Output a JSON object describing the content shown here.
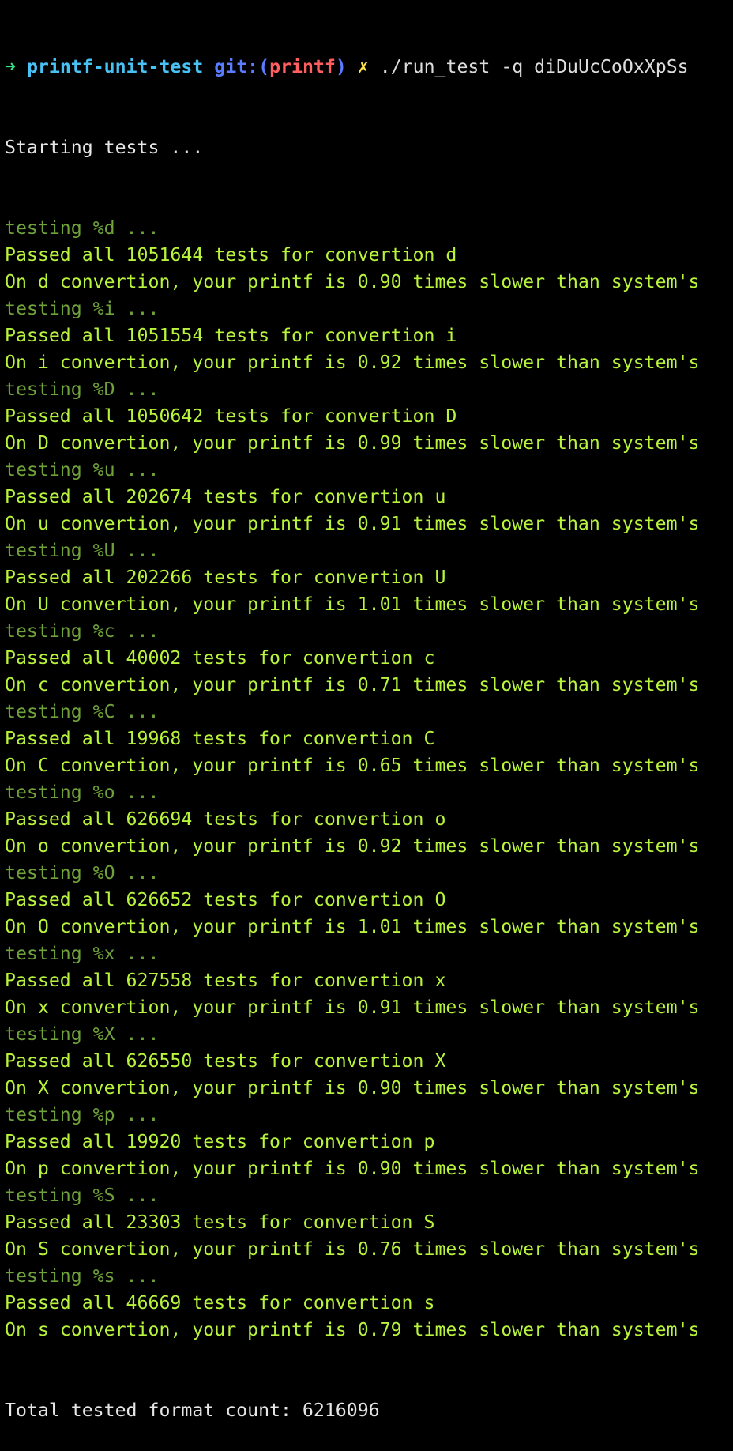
{
  "colors": {
    "background": "#000000",
    "prompt_arrow": "#39e088",
    "prompt_dir": "#48c2f4",
    "prompt_git": "#5a7cff",
    "prompt_branch": "#ff5f5f",
    "prompt_dirty": "#ffe34a",
    "plain_text": "#e6e6e6",
    "testing_text": "#6fa23a",
    "result_text": "#b9f43c"
  },
  "prompt": {
    "arrow": "➜",
    "directory": "printf-unit-test",
    "git_label": "git:",
    "branch_open": "(",
    "branch": "printf",
    "branch_close": ")",
    "dirty_mark": "✗",
    "command": "./run_test -q diDuUcCoOxXpSs"
  },
  "starting": "Starting tests ...",
  "conversions": [
    {
      "testing": "testing %d ...",
      "passed": "Passed all 1051644 tests for convertion d",
      "speed": "On d convertion, your printf is 0.90 times slower than system's"
    },
    {
      "testing": "testing %i ...",
      "passed": "Passed all 1051554 tests for convertion i",
      "speed": "On i convertion, your printf is 0.92 times slower than system's"
    },
    {
      "testing": "testing %D ...",
      "passed": "Passed all 1050642 tests for convertion D",
      "speed": "On D convertion, your printf is 0.99 times slower than system's"
    },
    {
      "testing": "testing %u ...",
      "passed": "Passed all 202674 tests for convertion u",
      "speed": "On u convertion, your printf is 0.91 times slower than system's"
    },
    {
      "testing": "testing %U ...",
      "passed": "Passed all 202266 tests for convertion U",
      "speed": "On U convertion, your printf is 1.01 times slower than system's"
    },
    {
      "testing": "testing %c ...",
      "passed": "Passed all 40002 tests for convertion c",
      "speed": "On c convertion, your printf is 0.71 times slower than system's"
    },
    {
      "testing": "testing %C ...",
      "passed": "Passed all 19968 tests for convertion C",
      "speed": "On C convertion, your printf is 0.65 times slower than system's"
    },
    {
      "testing": "testing %o ...",
      "passed": "Passed all 626694 tests for convertion o",
      "speed": "On o convertion, your printf is 0.92 times slower than system's"
    },
    {
      "testing": "testing %O ...",
      "passed": "Passed all 626652 tests for convertion O",
      "speed": "On O convertion, your printf is 1.01 times slower than system's"
    },
    {
      "testing": "testing %x ...",
      "passed": "Passed all 627558 tests for convertion x",
      "speed": "On x convertion, your printf is 0.91 times slower than system's"
    },
    {
      "testing": "testing %X ...",
      "passed": "Passed all 626550 tests for convertion X",
      "speed": "On X convertion, your printf is 0.90 times slower than system's"
    },
    {
      "testing": "testing %p ...",
      "passed": "Passed all 19920 tests for convertion p",
      "speed": "On p convertion, your printf is 0.90 times slower than system's"
    },
    {
      "testing": "testing %S ...",
      "passed": "Passed all 23303 tests for convertion S",
      "speed": "On S convertion, your printf is 0.76 times slower than system's"
    },
    {
      "testing": "testing %s ...",
      "passed": "Passed all 46669 tests for convertion s",
      "speed": "On s convertion, your printf is 0.79 times slower than system's"
    }
  ],
  "total": "Total tested format count: 6216096"
}
